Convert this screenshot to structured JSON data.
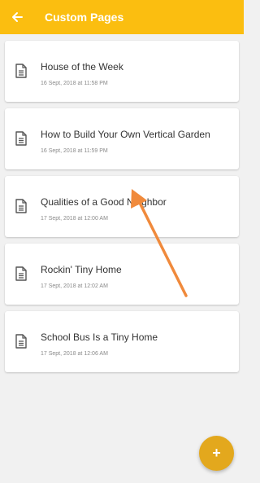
{
  "app": {
    "title": "Custom Pages",
    "accent_color": "#fbbe10",
    "fab_color": "#e3a81d"
  },
  "icons": {
    "back": "arrow-left-icon",
    "page": "document-icon",
    "add": "plus-icon"
  },
  "pages": [
    {
      "title": "House of the Week",
      "date": "16 Sept, 2018 at 11:58 PM"
    },
    {
      "title": "How to Build Your Own Vertical Garden",
      "date": "16 Sept, 2018 at 11:59 PM"
    },
    {
      "title": "Qualities of a Good Neighbor",
      "date": "17 Sept, 2018 at 12:00 AM"
    },
    {
      "title": "Rockin' Tiny Home",
      "date": "17 Sept, 2018 at 12:02 AM"
    },
    {
      "title": "School Bus Is a Tiny Home",
      "date": "17 Sept, 2018 at 12:06 AM"
    }
  ],
  "fab": {
    "label": "+"
  },
  "annotation": {
    "type": "arrow",
    "color": "#f08a3c",
    "points_to": "pages.2.title"
  }
}
